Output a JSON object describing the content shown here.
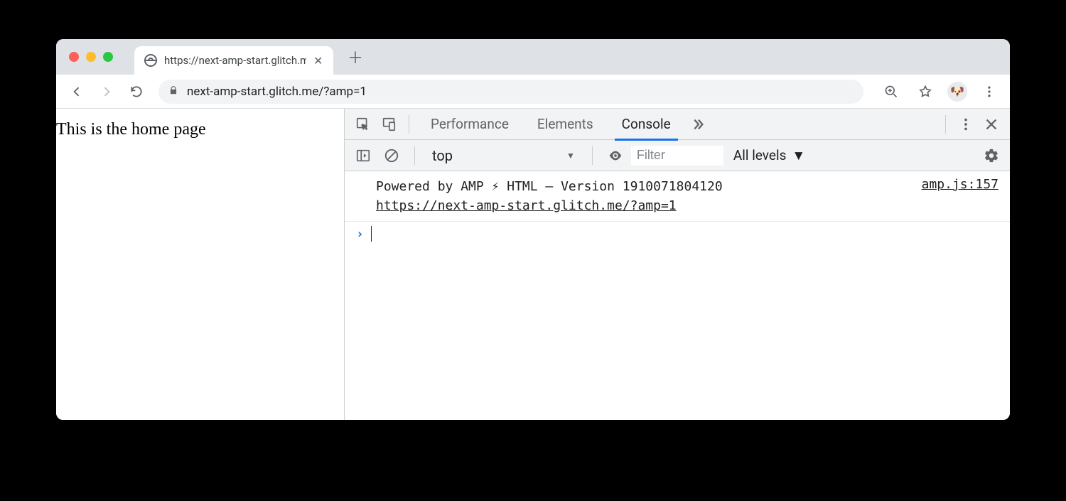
{
  "tab": {
    "title": "https://next-amp-start.glitch.m"
  },
  "toolbar": {
    "url": "next-amp-start.glitch.me/?amp=1"
  },
  "page": {
    "content": "This is the home page"
  },
  "devtools": {
    "tabs": {
      "performance": "Performance",
      "elements": "Elements",
      "console": "Console"
    },
    "console_toolbar": {
      "context": "top",
      "filter_placeholder": "Filter",
      "levels_label": "All levels"
    },
    "log": {
      "message_line1": "Powered by AMP ⚡ HTML – Version 1910071804120",
      "message_line2": "https://next-amp-start.glitch.me/?amp=1",
      "source": "amp.js:157"
    }
  }
}
